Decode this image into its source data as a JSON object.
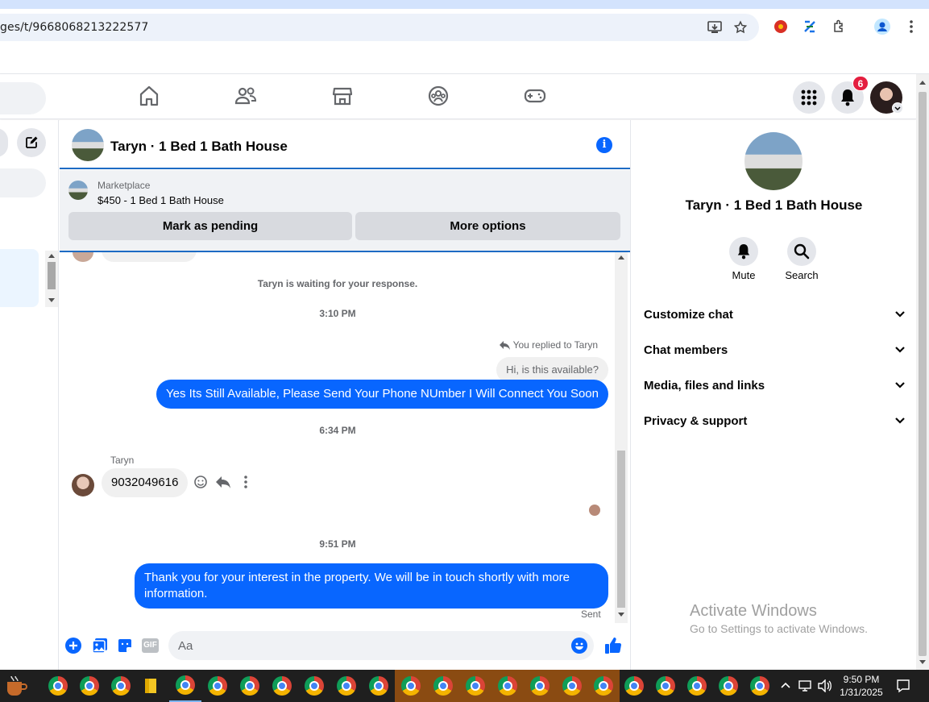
{
  "browser": {
    "url": "ges/t/9668068213222577"
  },
  "header": {
    "notification_count": "6"
  },
  "chat": {
    "title": "Taryn · 1 Bed 1 Bath House",
    "marketplace_label": "Marketplace",
    "listing": "$450 - 1 Bed 1 Bath House",
    "mark_pending_label": "Mark as pending",
    "more_options_label": "More options",
    "messages": {
      "waiting": "Taryn is waiting for your response.",
      "time1": "3:10 PM",
      "replied_to": "You replied to Taryn",
      "quoted": "Hi, is this available?",
      "sent1": "Yes Its Still Available, Please Send Your Phone NUmber I Will Connect You Soon",
      "time2": "6:34 PM",
      "sender_name": "Taryn",
      "received1": "9032049616",
      "time3": "9:51 PM",
      "sent2": "Thank you for your interest in the property. We will be in touch shortly with more information.",
      "status": "Sent"
    },
    "composer_placeholder": "Aa"
  },
  "details": {
    "title": "Taryn · 1 Bed 1 Bath House",
    "mute_label": "Mute",
    "search_label": "Search",
    "sections": [
      "Customize chat",
      "Chat members",
      "Media, files and links",
      "Privacy & support"
    ]
  },
  "watermark": {
    "line1": "Activate Windows",
    "line2": "Go to Settings to activate Windows."
  },
  "taskbar": {
    "time": "9:50 PM",
    "date": "1/31/2025"
  },
  "colors": {
    "accent": "#0866ff",
    "badge": "#e41e3f"
  }
}
